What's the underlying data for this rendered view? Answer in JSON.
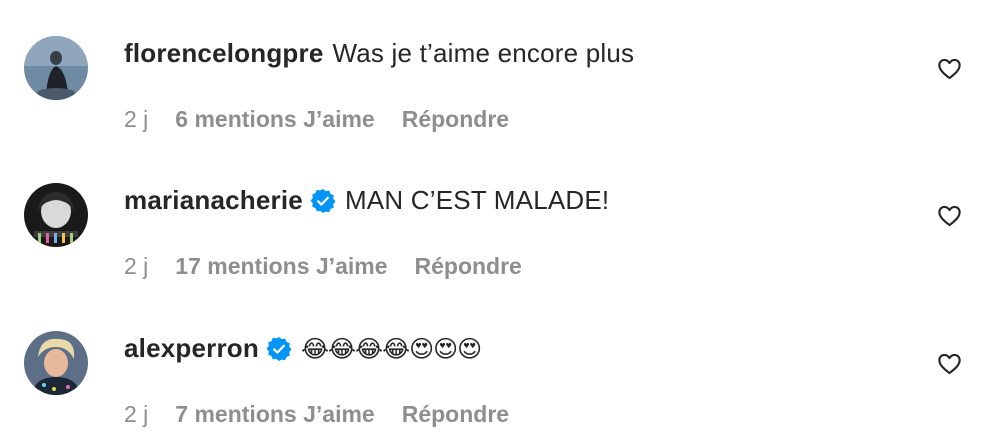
{
  "comments": [
    {
      "username": "florencelongpre",
      "verified": false,
      "text": "Was je t’aime encore plus",
      "time": "2 j",
      "likes": "6 mentions J’aime",
      "reply": "Répondre"
    },
    {
      "username": "marianacherie",
      "verified": true,
      "text": "MAN C’EST MALADE!",
      "time": "2 j",
      "likes": "17 mentions J’aime",
      "reply": "Répondre"
    },
    {
      "username": "alexperron",
      "verified": true,
      "text": "😂😂😂😂😍😍😍",
      "time": "2 j",
      "likes": "7 mentions J’aime",
      "reply": "Répondre"
    }
  ],
  "colors": {
    "text": "#262626",
    "secondary": "#8e8e8e",
    "verified": "#0095f6"
  }
}
